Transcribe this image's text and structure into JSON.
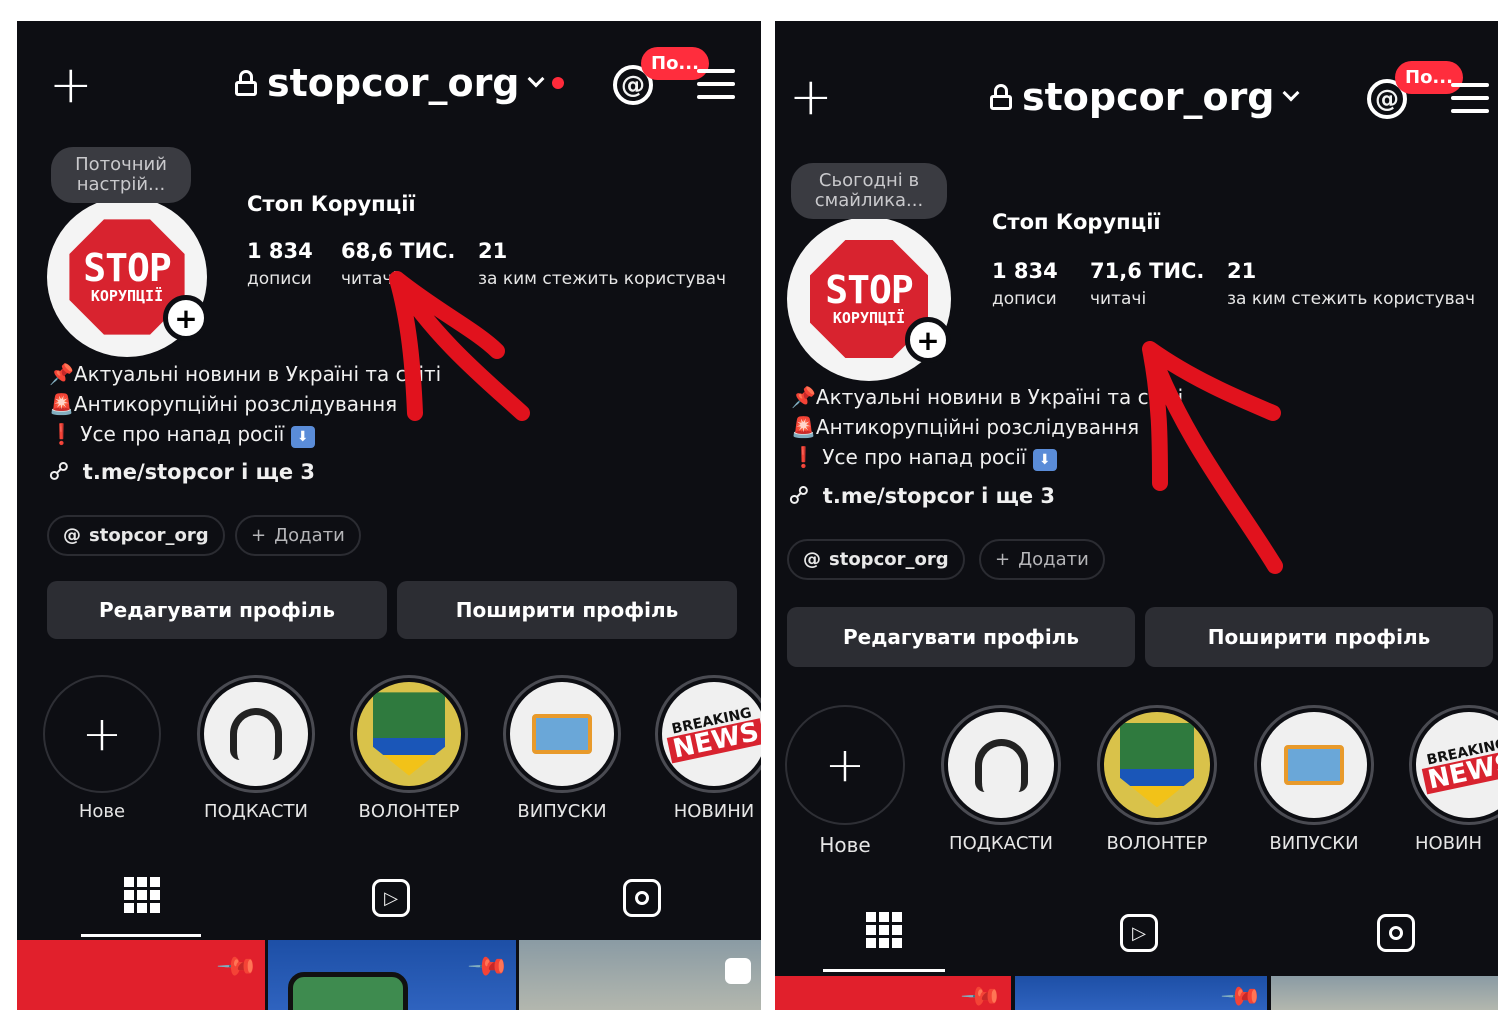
{
  "colors": {
    "background": "#0d0e13",
    "accent_red": "#ff2d3d",
    "button": "#2c2d33",
    "arrow": "#e1121d"
  },
  "panels": [
    {
      "id": "left",
      "username": "stopcor_org",
      "badge": "По...",
      "mood": "Поточний настрій...",
      "avatar_line1": "STOP",
      "avatar_line2": "КОРУПЦІЇ",
      "name": "Стоп Корупції",
      "posts_count": "1 834",
      "posts_label": "дописи",
      "followers_count": "68,6 ТИС.",
      "followers_label": "читачі",
      "following_count": "21",
      "following_label": "за ким стежить користувач",
      "bio": [
        "Актуальні новини в Україні та світі",
        "Антикорупційні розслідування",
        "Усе про напад росії"
      ],
      "link": "t.me/stopcor і ще 3",
      "threads_chip": "stopcor_org",
      "add_chip": "Додати",
      "edit_button": "Редагувати профіль",
      "share_button": "Поширити профіль",
      "highlights": [
        "Нове",
        "ПОДКАСТИ",
        "ВОЛОНТЕР",
        "ВИПУСКИ",
        "НОВИНИ"
      ],
      "news_text": [
        "BREAKING",
        "NEWS"
      ]
    },
    {
      "id": "right",
      "username": "stopcor_org",
      "badge": "По...",
      "mood": "Сьогодні в смайлика...",
      "avatar_line1": "STOP",
      "avatar_line2": "КОРУПЦІЇ",
      "name": "Стоп Корупції",
      "posts_count": "1 834",
      "posts_label": "дописи",
      "followers_count": "71,6 ТИС.",
      "followers_label": "читачі",
      "following_count": "21",
      "following_label": "за ким стежить користувач",
      "bio": [
        "Актуальні новини в Україні та світі",
        "Антикорупційні розслідування",
        "Усе про напад росії"
      ],
      "link": "t.me/stopcor і ще 3",
      "threads_chip": "stopcor_org",
      "add_chip": "Додати",
      "edit_button": "Редагувати профіль",
      "share_button": "Поширити профіль",
      "highlights": [
        "Нове",
        "ПОДКАСТИ",
        "ВОЛОНТЕР",
        "ВИПУСКИ",
        "НОВИН"
      ],
      "news_text": [
        "BREAKING",
        "NEWS"
      ]
    }
  ]
}
